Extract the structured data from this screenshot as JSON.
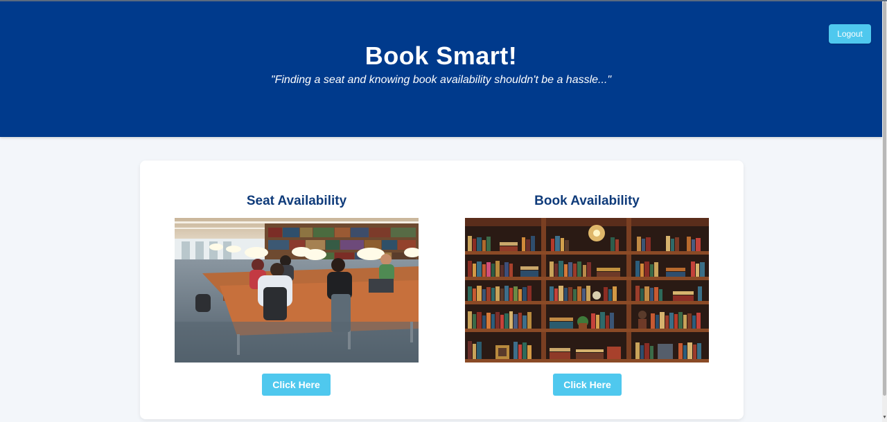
{
  "header": {
    "title": "Book Smart!",
    "tagline": "\"Finding a seat and knowing book availability shouldn't be a hassle...\"",
    "logout_label": "Logout",
    "background_color": "#003a8c"
  },
  "options": [
    {
      "title": "Seat Availability",
      "image": "library-reading-room-photo",
      "button_label": "Click Here"
    },
    {
      "title": "Book Availability",
      "image": "bookshelves-illustration",
      "button_label": "Click Here"
    }
  ],
  "colors": {
    "accent": "#4fc8ee",
    "heading": "#0f3b7a",
    "page_background": "#f3f6fa"
  }
}
